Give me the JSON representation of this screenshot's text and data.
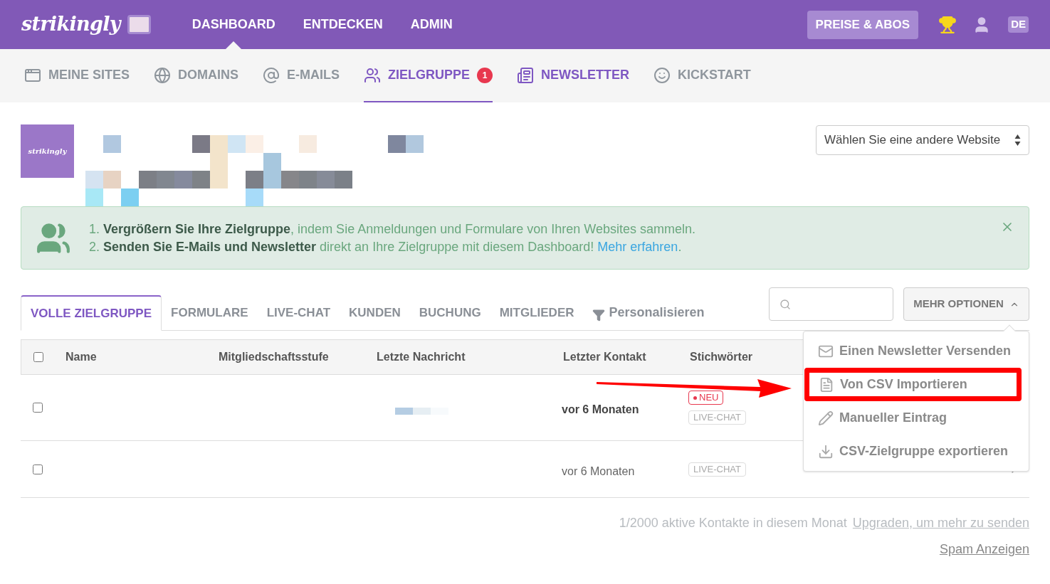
{
  "topbar": {
    "logo": "strikingly",
    "nav": [
      {
        "label": "DASHBOARD",
        "selected": true
      },
      {
        "label": "ENTDECKEN",
        "selected": false
      },
      {
        "label": "ADMIN",
        "selected": false
      }
    ],
    "pricing_button": "PREISE & ABOS",
    "language": "DE"
  },
  "subnav": [
    {
      "label": "MEINE SITES",
      "kind": "window",
      "selected": false,
      "highlighted": false
    },
    {
      "label": "DOMAINS",
      "kind": "www",
      "selected": false,
      "highlighted": false
    },
    {
      "label": "E-MAILS",
      "kind": "at",
      "selected": false,
      "highlighted": false
    },
    {
      "label": "ZIELGRUPPE",
      "kind": "users",
      "selected": true,
      "highlighted": true,
      "badge": "1"
    },
    {
      "label": "NEWSLETTER",
      "kind": "newsletter",
      "selected": false,
      "highlighted": true
    },
    {
      "label": "KICKSTART",
      "kind": "smile",
      "selected": false,
      "highlighted": false
    }
  ],
  "site": {
    "thumbnail_text": "strikingly",
    "site_select": "Wählen Sie eine andere Website"
  },
  "info_box": {
    "lines": [
      "1. **Vergrößern Sie Ihre Zielgruppe**, indem Sie Anmeldungen und Formulare von Ihren Websites sammeln.",
      "2. **Senden Sie E-Mails und Newsletter** direkt an Ihre Zielgruppe mit diesem Dashboard!"
    ],
    "link": "Mehr erfahren",
    "link_suffix": "."
  },
  "filter_tabs": [
    {
      "label": "VOLLE ZIELGRUPPE",
      "selected": true
    },
    {
      "label": "FORMULARE",
      "selected": false
    },
    {
      "label": "LIVE-CHAT",
      "selected": false
    },
    {
      "label": "KUNDEN",
      "selected": false
    },
    {
      "label": "BUCHUNG",
      "selected": false
    },
    {
      "label": "MITGLIEDER",
      "selected": false
    }
  ],
  "customize": "Personalisieren",
  "more_options": {
    "label": "MEHR OPTIONEN",
    "expanded": true,
    "items": [
      {
        "label": "Einen Newsletter Versenden",
        "kind": "mail",
        "highlighted": false
      },
      {
        "label": "Von CSV Importieren",
        "kind": "file",
        "highlighted": true
      },
      {
        "label": "Manueller Eintrag",
        "kind": "pencil",
        "highlighted": false
      },
      {
        "label": "CSV-Zielgruppe exportieren",
        "kind": "download",
        "highlighted": false
      }
    ]
  },
  "table": {
    "all_checked": false,
    "columns": [
      "Name",
      "Mitgliedschaftsstufe",
      "Letzte Nachricht",
      "Letzter Kontakt",
      "Stichwörter"
    ],
    "rows": [
      {
        "checked": false,
        "last_contact": "vor 6 Monaten",
        "unread": true,
        "tags": [
          {
            "label": "NEU",
            "kind": "new"
          },
          {
            "label": "LIVE-CHAT",
            "kind": "plain"
          }
        ]
      },
      {
        "checked": false,
        "last_contact": "vor 6 Monaten",
        "unread": false,
        "tags": [
          {
            "label": "LIVE-CHAT",
            "kind": "plain"
          }
        ]
      }
    ]
  },
  "footer": {
    "usage": "1/2000 aktive Kontakte in diesem Monat",
    "upgrade_link": "Upgraden, um mehr zu senden",
    "spam_link": "Spam Anzeigen"
  }
}
